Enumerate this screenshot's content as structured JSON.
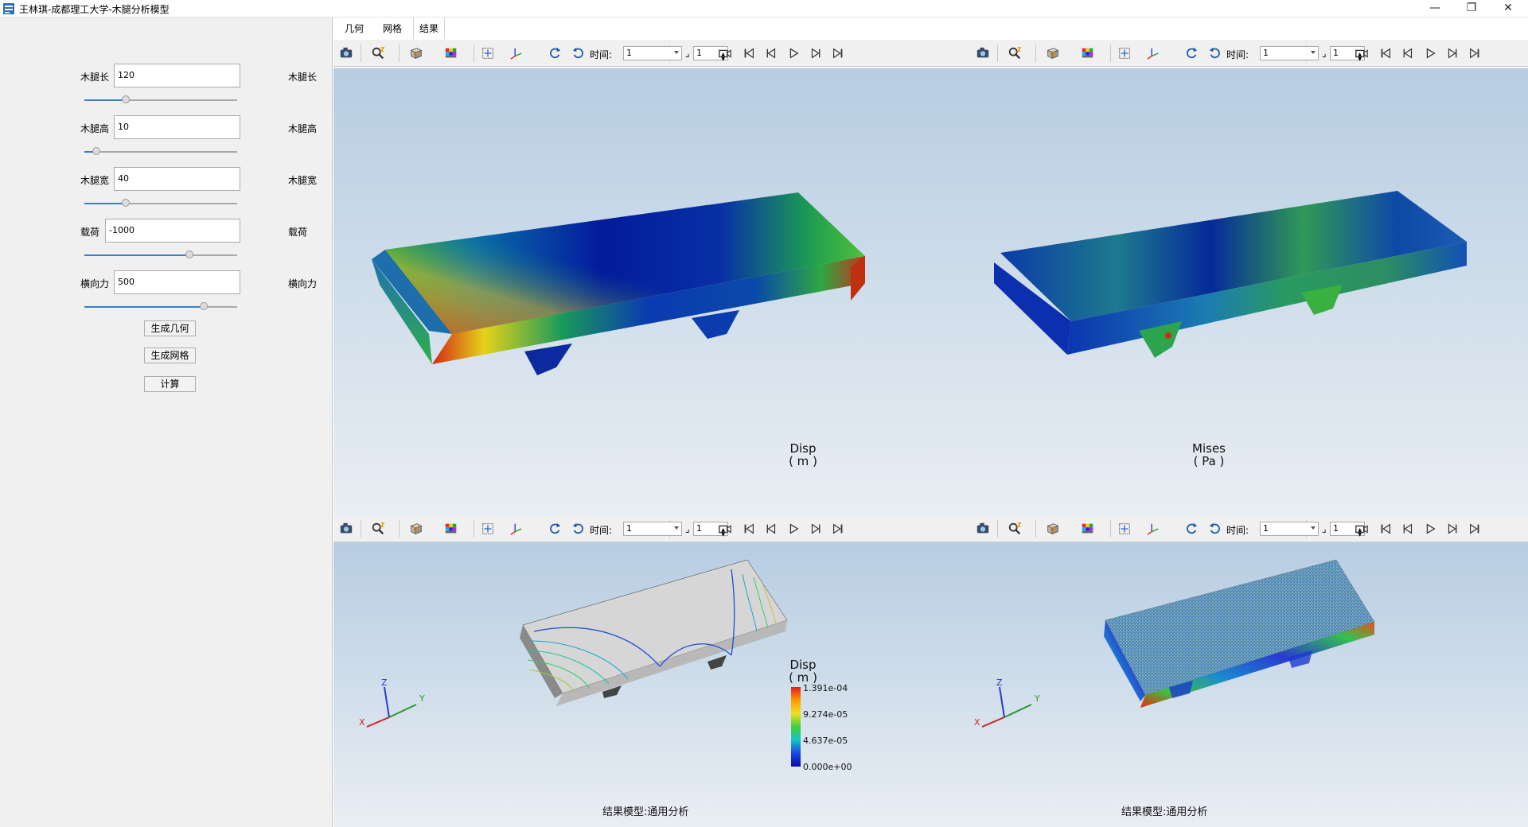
{
  "window": {
    "title": "王林琪-成都理工大学-木腿分析模型",
    "controls": {
      "minimize": "—",
      "restore": "❐",
      "close": "✕"
    }
  },
  "params": [
    {
      "label": "木腿长",
      "value": "120",
      "right_label": "木腿长",
      "slider": 0.27
    },
    {
      "label": "木腿高",
      "value": "10",
      "right_label": "木腿高",
      "slider": 0.08
    },
    {
      "label": "木腿宽",
      "value": "40",
      "right_label": "木腿宽",
      "slider": 0.27
    },
    {
      "label": "载荷",
      "value": "-1000",
      "right_label": "载荷",
      "slider": 0.69
    },
    {
      "label": "横向力",
      "value": "500",
      "right_label": "横向力",
      "slider": 0.78
    }
  ],
  "buttons": {
    "geometry": "生成几何",
    "mesh": "生成网格",
    "compute": "计算"
  },
  "tabs": [
    {
      "label": "几何"
    },
    {
      "label": "网格"
    },
    {
      "label": "结果"
    }
  ],
  "toolbar": {
    "time_label": "时间:",
    "time_value": "1",
    "step_value": "1"
  },
  "views": {
    "top_left": {
      "title": "Disp",
      "unit": "( m )"
    },
    "top_right": {
      "title": "Mises",
      "unit": "( Pa )"
    },
    "bottom_left": {
      "title": "Disp",
      "unit": "( m )",
      "caption": "结果模型:通用分析",
      "legend": {
        "max": "1.391e-04",
        "v2": "9.274e-05",
        "v3": "4.637e-05",
        "min": "0.000e+00"
      }
    },
    "bottom_right": {
      "caption": "结果模型:通用分析"
    }
  },
  "axes": {
    "x": "X",
    "y": "Y",
    "z": "Z"
  }
}
